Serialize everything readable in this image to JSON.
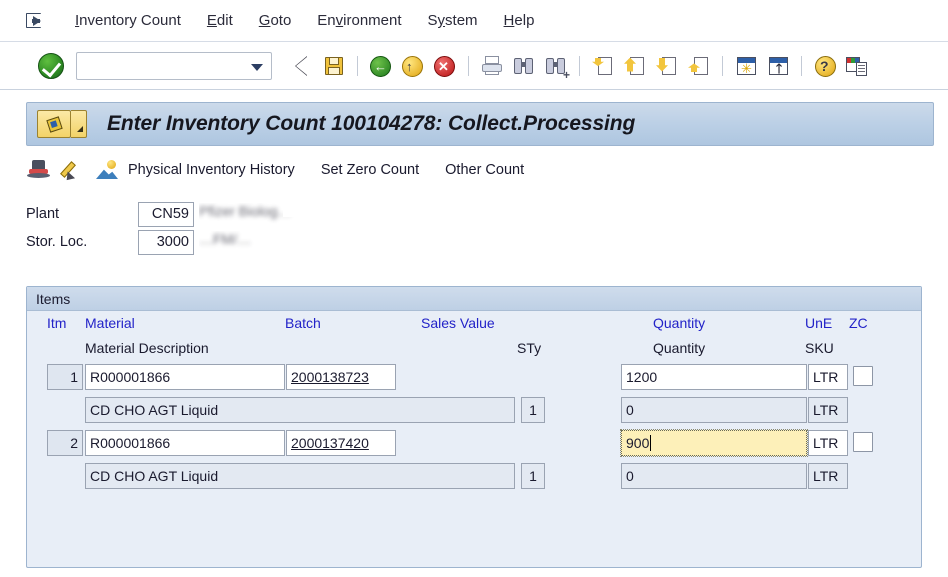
{
  "menubar": {
    "system_icon": "window-menu-icon",
    "items": [
      {
        "label": "Inventory Count",
        "accel": "I"
      },
      {
        "label": "Edit",
        "accel": "E"
      },
      {
        "label": "Goto",
        "accel": "G"
      },
      {
        "label": "Environment",
        "accel": "v"
      },
      {
        "label": "System",
        "accel": "y"
      },
      {
        "label": "Help",
        "accel": "H"
      }
    ]
  },
  "toolbar": {
    "ok_icon": "green-check-enter-icon",
    "command_field_value": "",
    "command_field_placeholder": "",
    "dropdown_icon": "chevron-down-icon",
    "icons": [
      "back-icon",
      "save-icon",
      "exit-icon",
      "cancel-up-icon",
      "stop-cancel-icon",
      "print-icon",
      "find-icon",
      "find-next-icon",
      "first-page-icon",
      "previous-page-icon",
      "next-page-icon",
      "last-page-icon",
      "new-session-icon",
      "create-shortcut-icon",
      "help-icon",
      "layout-menu-icon"
    ]
  },
  "title_bar": {
    "icon": "transaction-edit-icon",
    "dropdown_icon": "title-dropdown-icon",
    "text": "Enter Inventory Count 100104278: Collect.Processing"
  },
  "app_toolbar": {
    "icons": [
      "delete-bucket-icon",
      "edit-pencil-icon",
      "display-picture-icon"
    ],
    "buttons": [
      "Physical Inventory History",
      "Set Zero Count",
      "Other Count"
    ]
  },
  "key_fields": [
    {
      "label": "Plant",
      "value": "CN59",
      "description": "Pfizer Biolog…",
      "redacted": true
    },
    {
      "label": "Stor. Loc.",
      "value": "3000",
      "description": "…FM/…",
      "redacted": true
    }
  ],
  "items_panel": {
    "title": "Items",
    "headers_main": [
      "Itm",
      "Material",
      "Batch",
      "Sales Value",
      "Quantity",
      "UnE",
      "ZC"
    ],
    "headers_sub": [
      "Material Description",
      "STy",
      "Quantity",
      "SKU"
    ],
    "rows": [
      {
        "itm": "1",
        "material": "R000001866",
        "batch": "2000138723",
        "quantity": "1200",
        "unit": "LTR",
        "zc_checked": false,
        "focused": false,
        "description": "CD CHO AGT Liquid",
        "sty": "1",
        "sub_quantity": "0",
        "sku": "LTR"
      },
      {
        "itm": "2",
        "material": "R000001866",
        "batch": "2000137420",
        "quantity": "900",
        "unit": "LTR",
        "zc_checked": false,
        "focused": true,
        "description": "CD CHO AGT Liquid",
        "sty": "1",
        "sub_quantity": "0",
        "sku": "LTR"
      }
    ]
  },
  "colors": {
    "header_blue": "#2222c8",
    "panel_bg": "#e8eef7",
    "title_band": "#bcd0e6",
    "focus_yellow": "#fdf0b9",
    "readonly_grey": "#e3e9f2"
  }
}
